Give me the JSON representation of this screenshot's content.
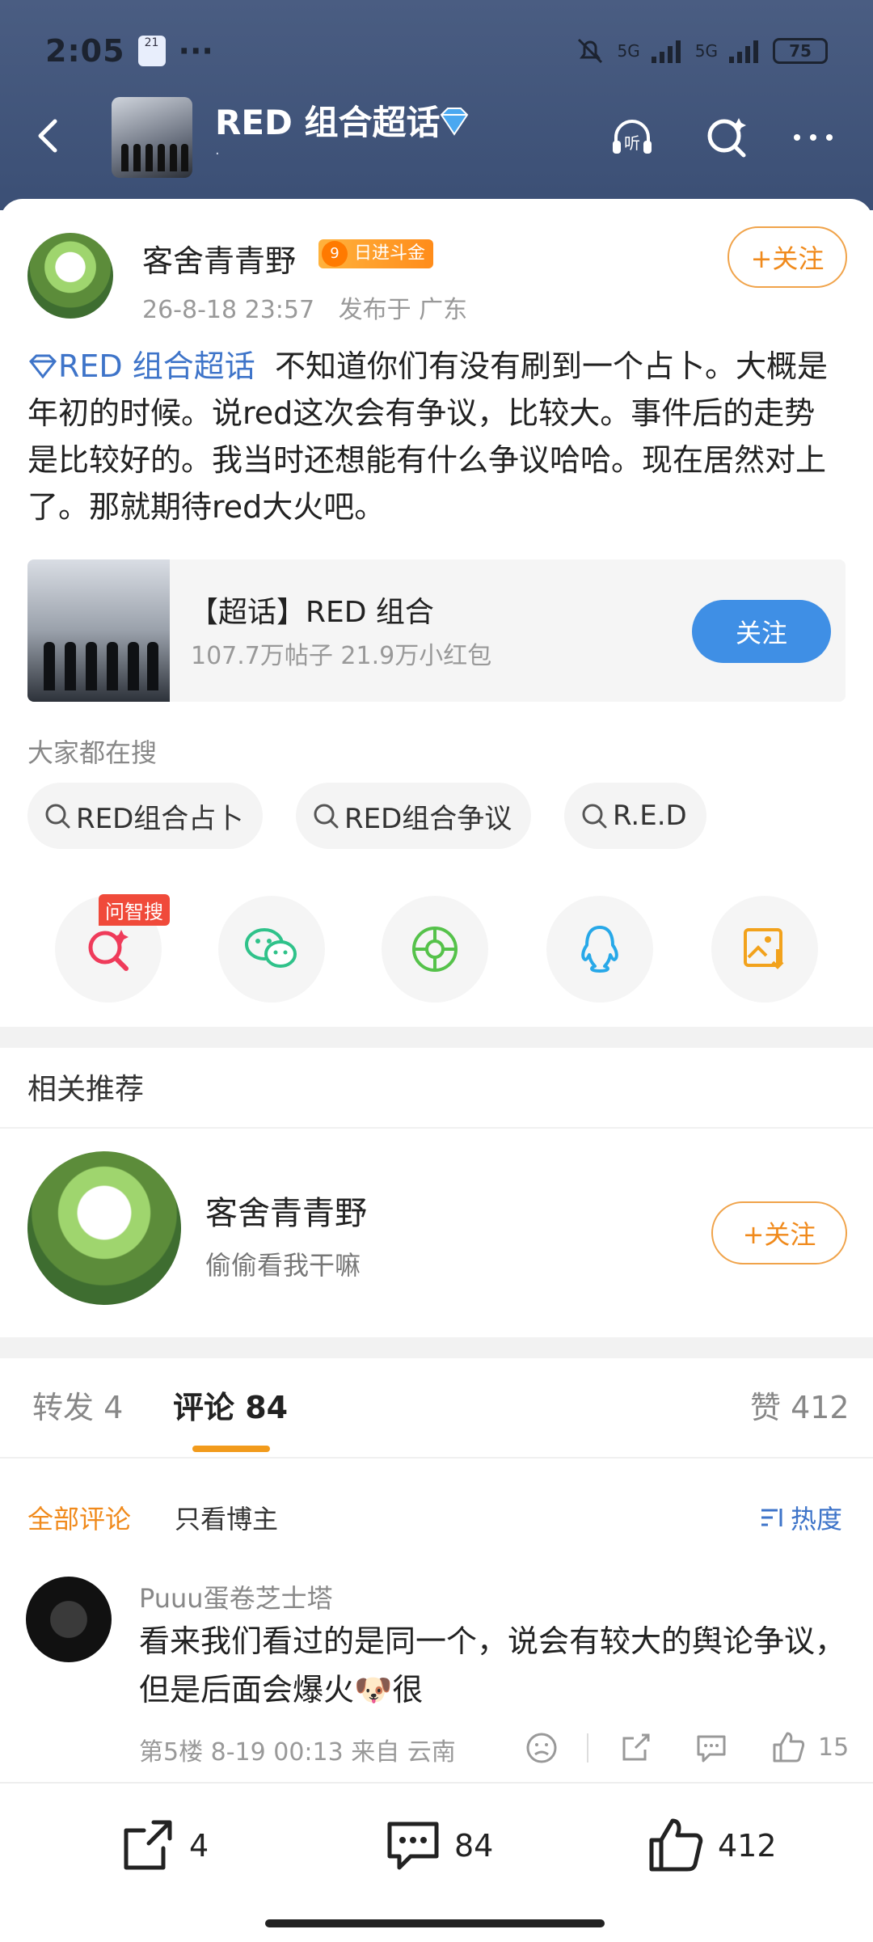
{
  "status_bar": {
    "time": "2:05",
    "app_badge": "21",
    "dots": "···",
    "network1": "5G",
    "network2": "5G",
    "battery": "75"
  },
  "header": {
    "title": "RED 组合超话",
    "subtitle": "·"
  },
  "post": {
    "author": "客舍青青野",
    "badge_level": "9",
    "badge_text": "日进斗金",
    "time": "26-8-18 23:57",
    "location": "发布于 广东",
    "follow_label": "+关注",
    "topic": "RED 组合超话",
    "content": "不知道你们有没有刷到一个占卜。大概是年初的时候。说red这次会有争议，比较大。事件后的走势是比较好的。我当时还想能有什么争议哈哈。现在居然对上了。那就期待red大火吧。"
  },
  "supertopic_card": {
    "title": "【超话】RED 组合",
    "stats": "107.7万帖子 21.9万小红包",
    "button": "关注"
  },
  "search": {
    "label": "大家都在搜",
    "chips": [
      "RED组合占卜",
      "RED组合争议",
      "R.E.D"
    ]
  },
  "share": {
    "hot_tag": "问智搜"
  },
  "related": {
    "title": "相关推荐",
    "name": "客舍青青野",
    "signature": "偷偷看我干嘛",
    "follow_label": "+关注"
  },
  "tabs": {
    "repost": "转发 4",
    "comment": "评论 84",
    "like": "赞 412"
  },
  "filters": {
    "all": "全部评论",
    "author_only": "只看博主",
    "sort": "热度"
  },
  "comment": {
    "user": "Puuu蛋卷芝士塔",
    "text": "看来我们看过的是同一个，说会有较大的舆论争议，但是后面会爆火🐶很",
    "meta": "第5楼  8-19 00:13  来自 云南",
    "likes": "15"
  },
  "bottom_bar": {
    "repost": "4",
    "comment": "84",
    "like": "412"
  },
  "colors": {
    "accent": "#f29b1c",
    "topic_blue": "#3e74c9",
    "button_blue": "#3f8fe5",
    "header_bg": "#41557c"
  }
}
